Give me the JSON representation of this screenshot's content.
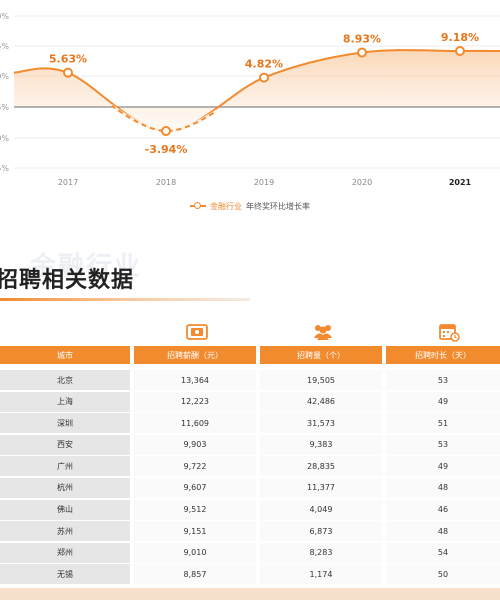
{
  "chart_data": {
    "type": "line",
    "x": [
      "2017",
      "2018",
      "2019",
      "2020",
      "2021"
    ],
    "series": [
      {
        "name": "年终奖环比增长率",
        "values": [
          5.63,
          -3.94,
          4.82,
          8.93,
          9.18
        ],
        "labels": [
          "5.63%",
          "-3.94%",
          "4.82%",
          "8.93%",
          "9.18%"
        ]
      }
    ],
    "ylim": [
      -15,
      15
    ],
    "ytick_labels": [
      "0%",
      "5%",
      "0%",
      "5%",
      "0%",
      "5%"
    ],
    "legend_position": "bottom",
    "accent": "#f28a2e"
  },
  "legend": {
    "prefix": "金融行业",
    "label": "年终奖环比增长率"
  },
  "watermark": "金融行业",
  "section_title": "招聘相关数据",
  "table": {
    "headers": [
      "城市",
      "招聘薪酬（元）",
      "招聘量（个）",
      "招聘时长（天）"
    ],
    "header_icons": [
      "money-icon",
      "people-icon",
      "calendar-clock-icon"
    ],
    "rows": [
      [
        "北京",
        "13,364",
        "19,505",
        "53"
      ],
      [
        "上海",
        "12,223",
        "42,486",
        "49"
      ],
      [
        "深圳",
        "11,609",
        "31,573",
        "51"
      ],
      [
        "西安",
        "9,903",
        "9,383",
        "53"
      ],
      [
        "广州",
        "9,722",
        "28,835",
        "49"
      ],
      [
        "杭州",
        "9,607",
        "11,377",
        "48"
      ],
      [
        "佛山",
        "9,512",
        "4,049",
        "46"
      ],
      [
        "苏州",
        "9,151",
        "6,873",
        "48"
      ],
      [
        "郑州",
        "9,010",
        "8,283",
        "54"
      ],
      [
        "无锡",
        "8,857",
        "1,174",
        "50"
      ]
    ]
  },
  "colors": {
    "accent": "#f28a2e",
    "header_text": "#ffffff",
    "city_bg": "#e6e6e6"
  }
}
